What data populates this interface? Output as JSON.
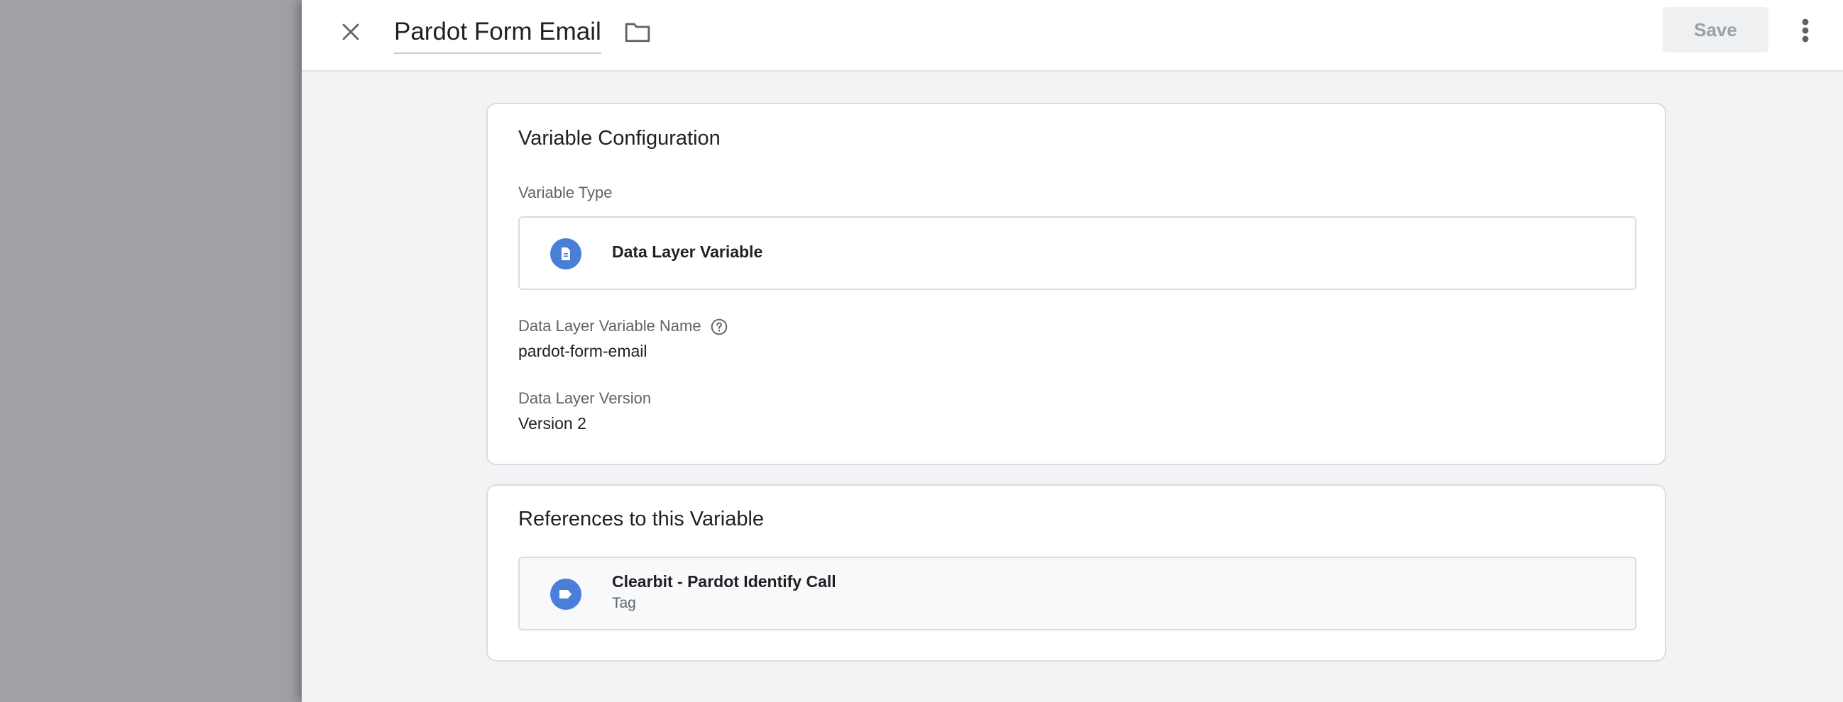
{
  "header": {
    "title": "Pardot Form Email",
    "save_label": "Save",
    "icons": {
      "close": "close-icon",
      "folder": "folder-icon",
      "more": "more-vert-icon"
    }
  },
  "config": {
    "heading": "Variable Configuration",
    "type_label": "Variable Type",
    "type_value": "Data Layer Variable",
    "type_icon": "document-icon",
    "name_label": "Data Layer Variable Name",
    "name_value": "pardot-form-email",
    "version_label": "Data Layer Version",
    "version_value": "Version 2"
  },
  "references": {
    "heading": "References to this Variable",
    "items": [
      {
        "name": "Clearbit - Pardot Identify Call",
        "kind": "Tag",
        "icon": "tag-icon"
      }
    ]
  },
  "colors": {
    "accent": "#4a7fd9",
    "panel_bg": "#f1f3f4",
    "backdrop": "#9fa1a4"
  }
}
